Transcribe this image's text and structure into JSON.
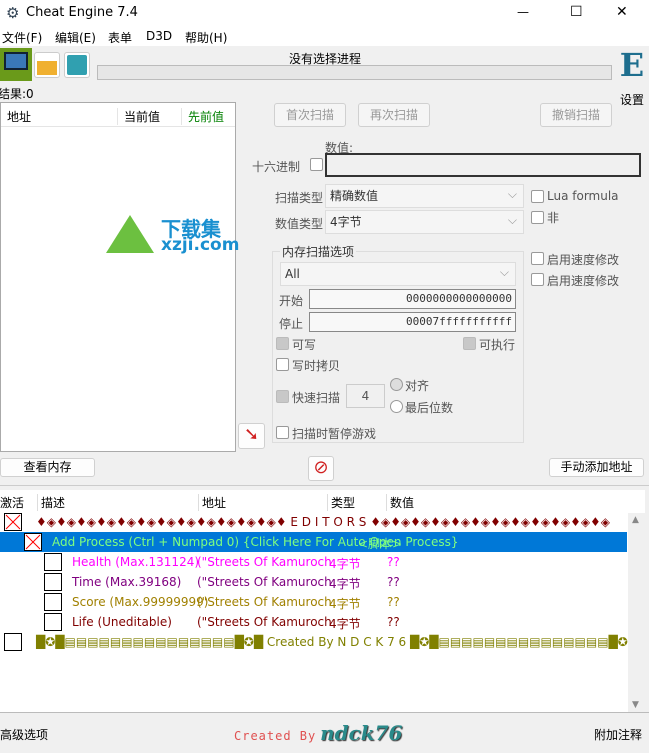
{
  "window": {
    "title": "Cheat Engine 7.4",
    "controls": [
      "—",
      "☐",
      "✕"
    ]
  },
  "menu": [
    "文件(F)",
    "编辑(E)",
    "表单",
    "D3D",
    "帮助(H)"
  ],
  "toolbar": {
    "process_label": "没有选择进程",
    "settings_label": "设置"
  },
  "results": {
    "label": "结果:0"
  },
  "found_list": {
    "columns": [
      "地址",
      "当前值",
      "先前值"
    ],
    "prev_color": "#008000"
  },
  "watermark": {
    "text1": "下载集",
    "text2": "xzji.com"
  },
  "scan": {
    "first": "首次扫描",
    "next": "再次扫描",
    "undo": "撤销扫描",
    "value_label": "数值:",
    "hex_label": "十六进制",
    "value": "",
    "scan_type_label": "扫描类型",
    "scan_type": "精确数值",
    "value_type_label": "数值类型",
    "value_type": "4字节",
    "lua_formula": "Lua formula",
    "not_label": "非",
    "mem_group": "内存扫描选项",
    "region": "All",
    "start_label": "开始",
    "start": "0000000000000000",
    "stop_label": "停止",
    "stop": "00007fffffffffff",
    "writable": "可写",
    "executable": "可执行",
    "copy_on_write": "写时拷贝",
    "fast_scan": "快速扫描",
    "fast_value": "4",
    "align": "对齐",
    "last_digits": "最后位数",
    "pause": "扫描时暂停游戏",
    "speedhack1": "启用速度修改",
    "speedhack2": "启用速度修改"
  },
  "buttons": {
    "view_memory": "查看内存",
    "add_manual": "手动添加地址"
  },
  "table": {
    "columns": [
      "激活",
      "描述",
      "地址",
      "类型",
      "数值"
    ],
    "rows": [
      {
        "desc": "♦◈♦◈♦◈♦◈♦◈♦◈♦◈♦◈♦◈♦◈♦◈♦◈♦     E  D  I  T  O  R  S     ♦◈♦◈♦◈♦◈♦◈♦◈♦◈♦◈♦◈♦◈♦◈♦◈",
        "color": "#800000",
        "check": "x"
      },
      {
        "desc": "Add Process (Ctrl + Numpad 0) {Click Here For Auto Open Process}",
        "type": "<脚本>",
        "color": "#7fff7f",
        "check": "x",
        "selected": true
      },
      {
        "desc": "Health (Max.131124)",
        "addr": "(\"Streets Of Kamuroch",
        "type": "4字节",
        "value": "??",
        "color": "#ff00ff"
      },
      {
        "desc": "Time (Max.39168)",
        "addr": "(\"Streets Of Kamuroch",
        "type": "4字节",
        "value": "??",
        "color": "#800080"
      },
      {
        "desc": "Score (Max.99999999)",
        "addr": "(\"Streets Of Kamuroch",
        "type": "4字节",
        "value": "??",
        "color": "#a08000"
      },
      {
        "desc": "Life (Uneditable)",
        "addr": "(\"Streets Of Kamuroch",
        "type": "4字节",
        "value": "??",
        "color": "#800000"
      },
      {
        "desc": "█✪█▤▤▤▤▤▤▤▤▤▤▤▤▤▤▤█✪█     Created    By    N D C K 7 6     █✪█▤▤▤▤▤▤▤▤▤▤▤▤▤▤▤█✪",
        "color": "#808000",
        "check": ""
      }
    ]
  },
  "footer": {
    "advanced": "高级选项",
    "logo": "Created By ndck76",
    "comments": "附加注释"
  },
  "colors": {
    "selection": "#0078d7",
    "accent": "#1e8ab4"
  }
}
